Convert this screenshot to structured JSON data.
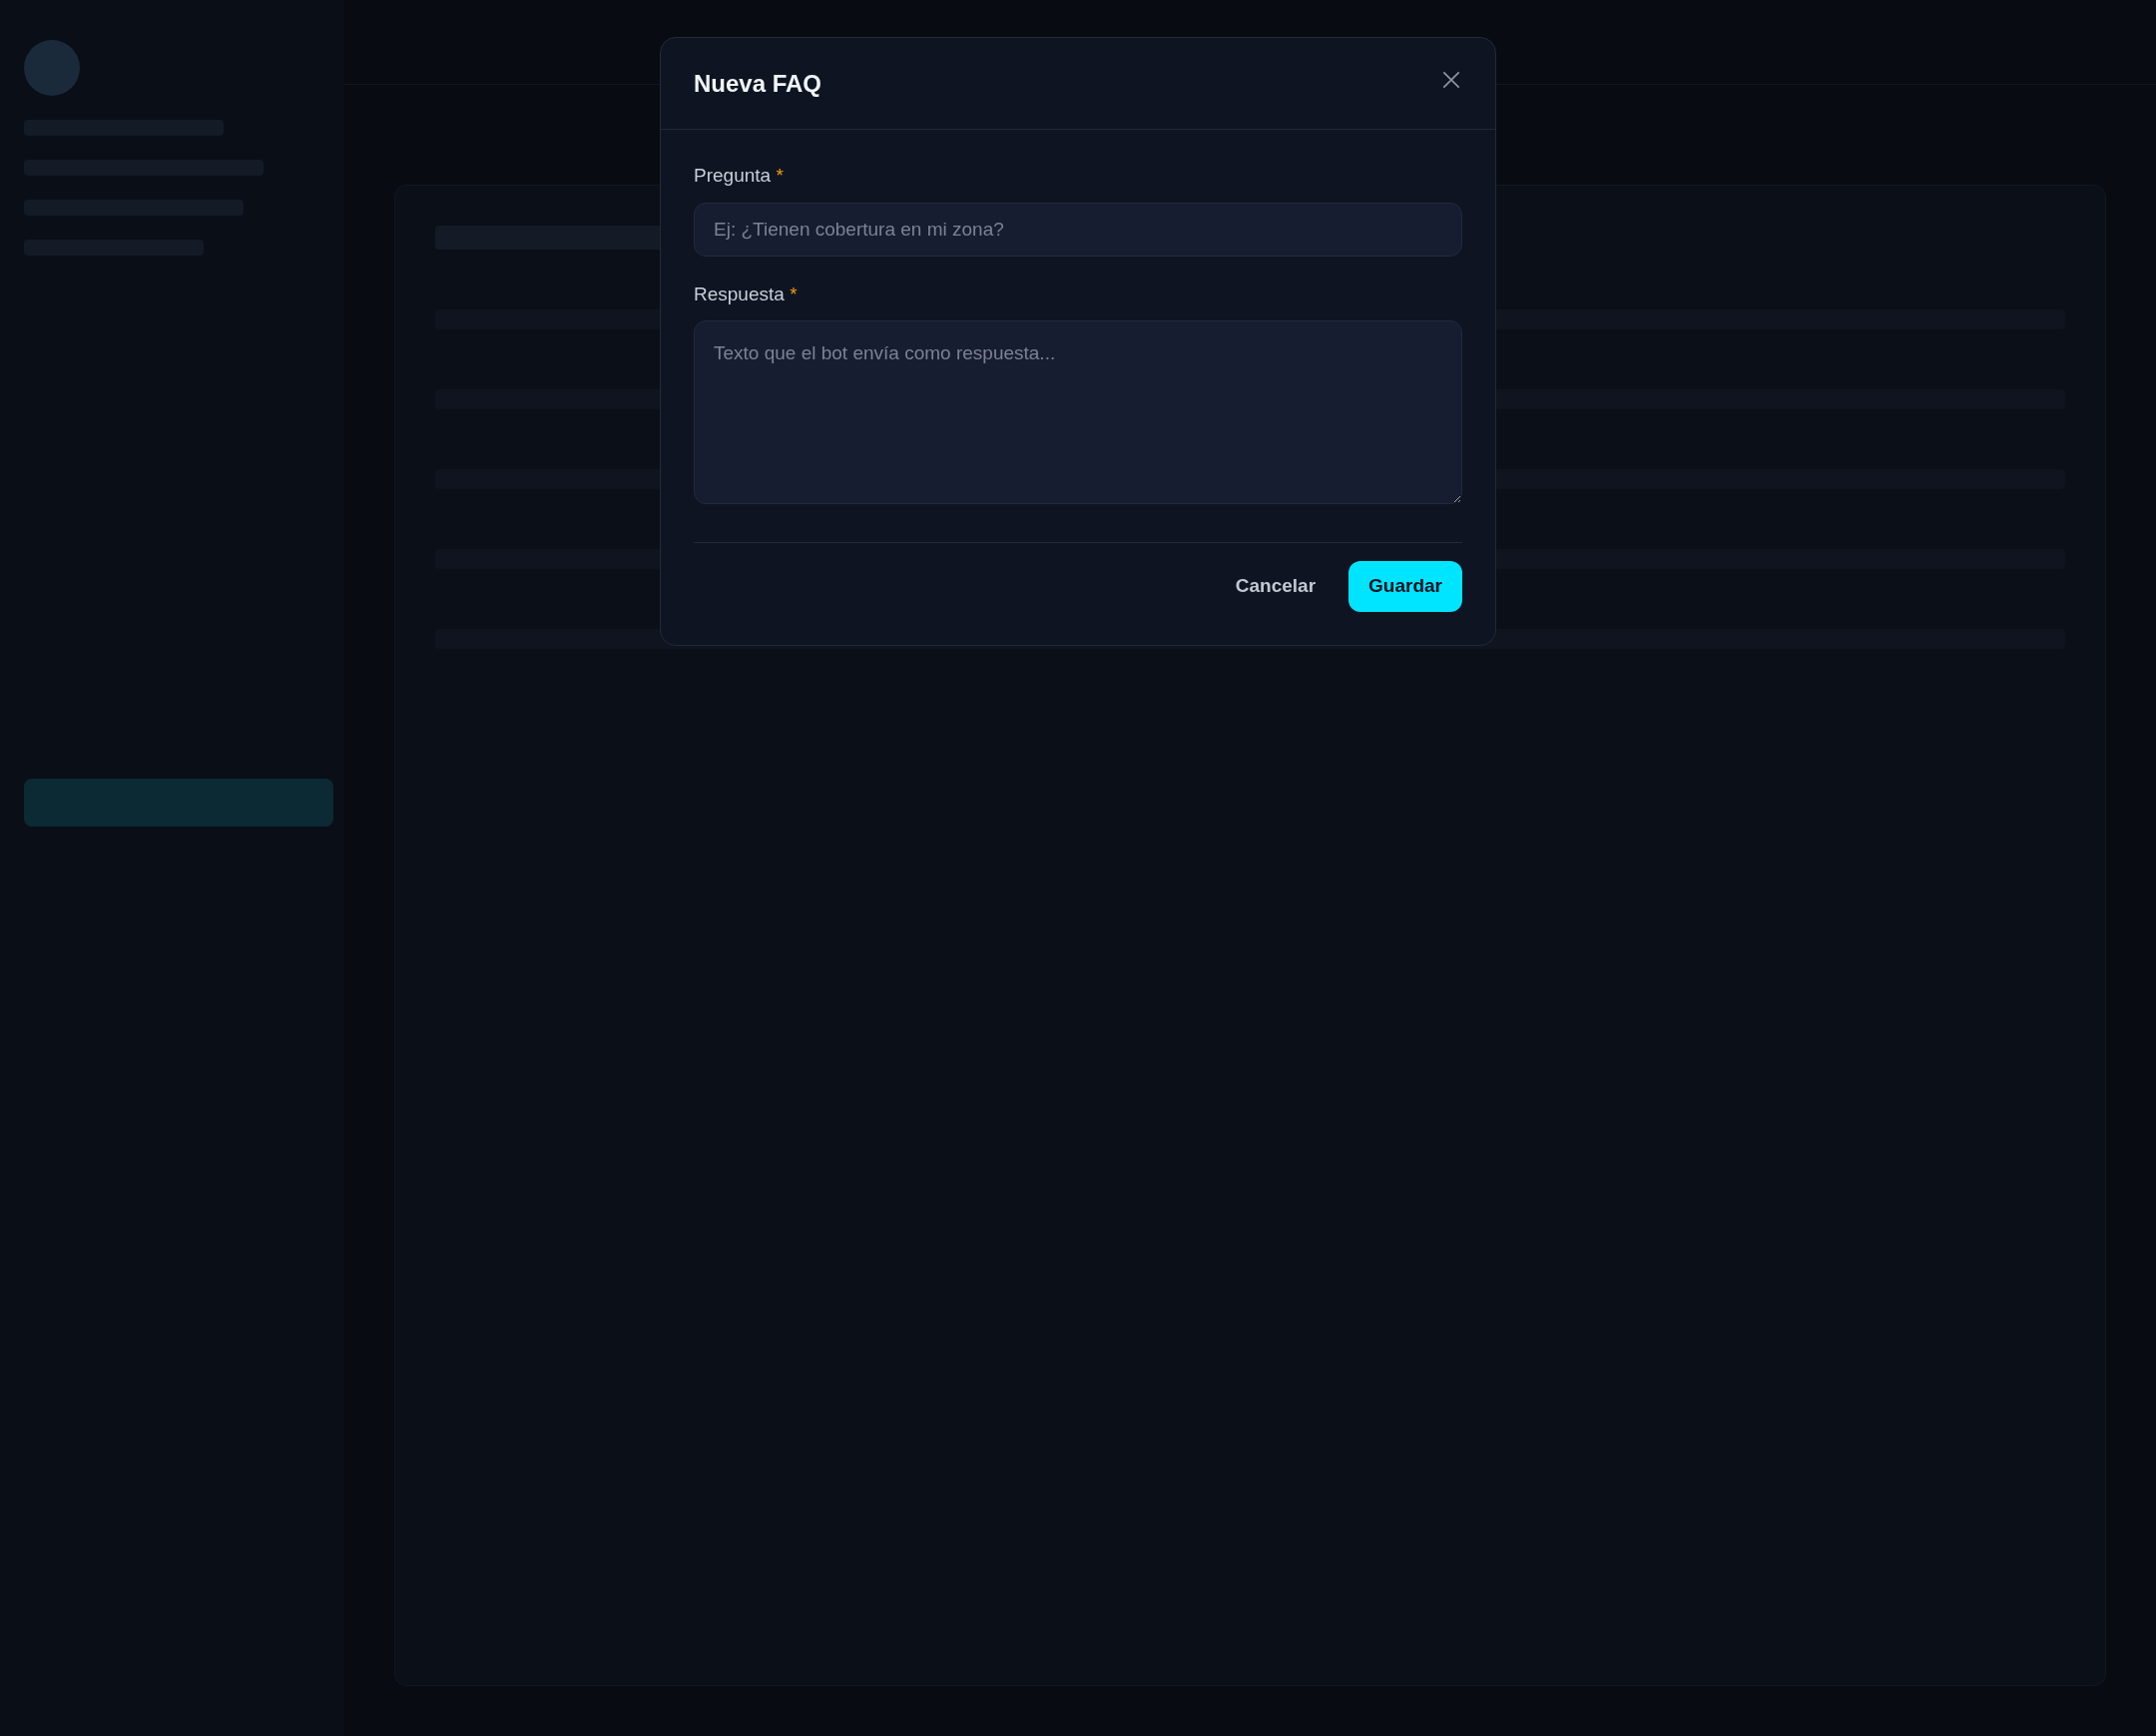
{
  "dialog": {
    "title": "Nueva FAQ",
    "fields": [
      {
        "kind": "input",
        "label": "Pregunta",
        "required_mark": "*",
        "placeholder": "Ej: ¿Tienen cobertura en mi zona?"
      },
      {
        "kind": "textarea",
        "label": "Respuesta",
        "required_mark": "*",
        "placeholder": "Texto que el bot envía como respuesta..."
      }
    ],
    "buttons": [
      {
        "kind": "secondary",
        "label": "Cancelar"
      },
      {
        "kind": "primary",
        "label": "Guardar"
      }
    ]
  }
}
